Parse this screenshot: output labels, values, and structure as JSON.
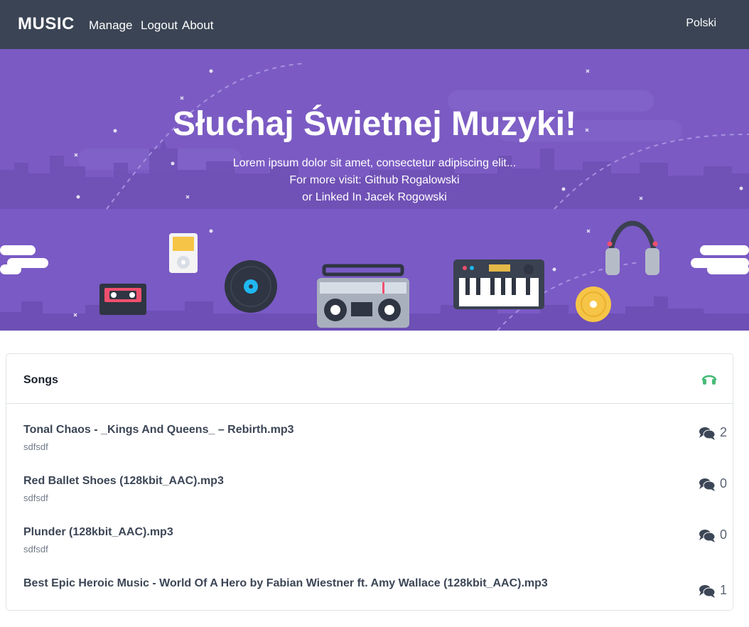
{
  "navbar": {
    "brand": "MUSIC",
    "links": [
      "Manage",
      "Logout",
      "About"
    ],
    "language": "Polski"
  },
  "hero": {
    "title": "Słuchaj Świetnej Muzyki!",
    "lines": [
      "Lorem ipsum dolor sit amet, consectetur adipiscing elit...",
      "For more visit: Github Rogalowski",
      "or Linked In Jacek Rogowski"
    ]
  },
  "songs_card": {
    "title": "Songs",
    "header_icon": "headphones-icon",
    "items": [
      {
        "title": "Tonal Chaos - _Kings And Queens_ – Rebirth.mp3",
        "subtitle": "sdfsdf",
        "comments": "2"
      },
      {
        "title": "Red Ballet Shoes (128kbit_AAC).mp3",
        "subtitle": "sdfsdf",
        "comments": "0"
      },
      {
        "title": "Plunder (128kbit_AAC).mp3",
        "subtitle": "sdfsdf",
        "comments": "0"
      },
      {
        "title": "Best Epic Heroic Music - World Of A Hero by Fabian Wiestner ft. Amy Wallace (128kbit_AAC).mp3",
        "subtitle": "",
        "comments": "1"
      }
    ]
  },
  "colors": {
    "navbar": "#3a4454",
    "hero_purple": "#7c5cc4",
    "accent_green": "#48bb78"
  }
}
